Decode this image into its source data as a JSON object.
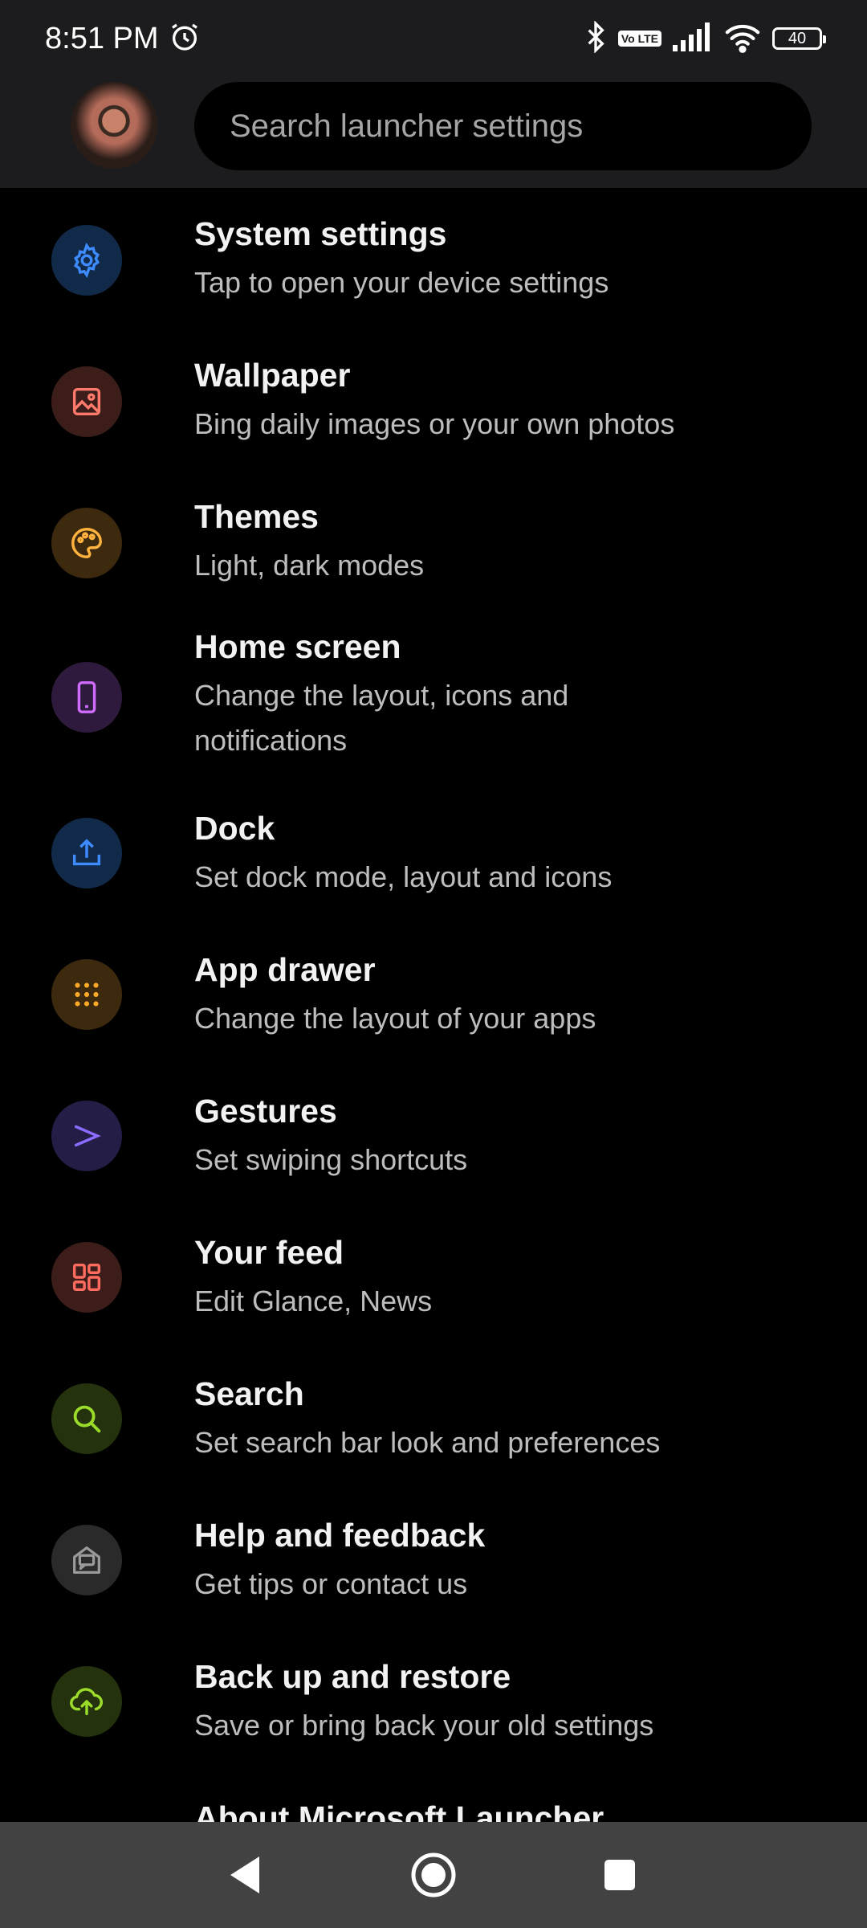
{
  "status_bar": {
    "time": "8:51 PM",
    "volte_label": "Vo LTE",
    "battery": "40"
  },
  "header": {
    "search_placeholder": "Search launcher settings"
  },
  "settings": [
    {
      "title": "System settings",
      "subtitle": "Tap to open your device settings",
      "icon": "gear-icon",
      "color": "#3d8bff",
      "bg": "#122a4a"
    },
    {
      "title": "Wallpaper",
      "subtitle": "Bing daily images or your own photos",
      "icon": "image-icon",
      "color": "#ff7a6b",
      "bg": "#3d1d1a"
    },
    {
      "title": "Themes",
      "subtitle": "Light, dark modes",
      "icon": "palette-icon",
      "color": "#ffb23e",
      "bg": "#3d2a0e"
    },
    {
      "title": "Home screen",
      "subtitle": "Change the layout, icons and notifications",
      "icon": "phone-icon",
      "color": "#cf6cff",
      "bg": "#2e1a3d"
    },
    {
      "title": "Dock",
      "subtitle": "Set dock mode, layout and icons",
      "icon": "upload-icon",
      "color": "#3d8bff",
      "bg": "#122a4a"
    },
    {
      "title": "App drawer",
      "subtitle": "Change the layout of your apps",
      "icon": "grid-dots-icon",
      "color": "#ffa928",
      "bg": "#3d2a0e"
    },
    {
      "title": "Gestures",
      "subtitle": "Set swiping shortcuts",
      "icon": "gesture-icon",
      "color": "#8b6cff",
      "bg": "#241d45"
    },
    {
      "title": "Your feed",
      "subtitle": "Edit Glance, News",
      "icon": "dashboard-icon",
      "color": "#ff6b5e",
      "bg": "#3d1d1a"
    },
    {
      "title": "Search",
      "subtitle": "Set search bar look and preferences",
      "icon": "search-icon",
      "color": "#9bdb2a",
      "bg": "#24330d"
    },
    {
      "title": "Help and feedback",
      "subtitle": "Get tips or contact us",
      "icon": "help-mail-icon",
      "color": "#9a9a9a",
      "bg": "#2a2a2a"
    },
    {
      "title": "Back up and restore",
      "subtitle": "Save or bring back your old settings",
      "icon": "cloud-upload-icon",
      "color": "#9bdb2a",
      "bg": "#24330d"
    },
    {
      "title": "About Microsoft Launcher",
      "subtitle": "",
      "icon": "",
      "color": "",
      "bg": ""
    }
  ]
}
